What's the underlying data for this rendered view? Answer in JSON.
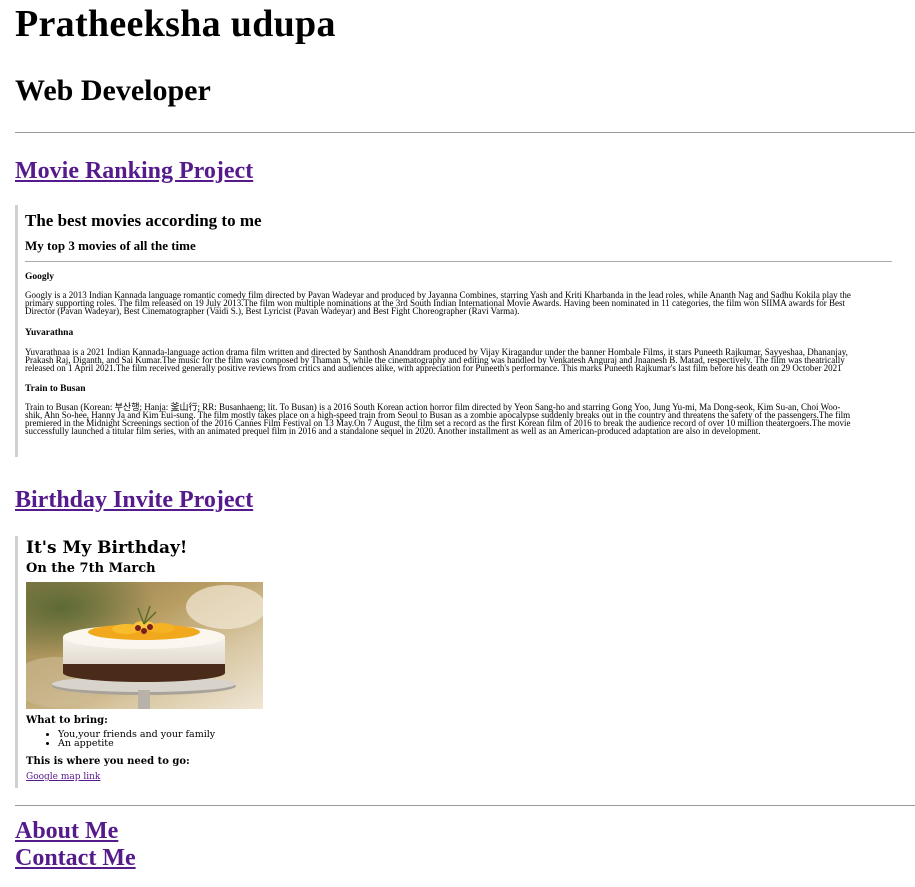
{
  "header": {
    "name": "Pratheeksha udupa",
    "role": "Web Developer"
  },
  "projects": {
    "movie_link": "Movie Ranking Project",
    "birthday_link": "Birthday Invite Project"
  },
  "movie_page": {
    "title": "The best movies according to me",
    "subtitle": "My top 3 movies of all the time",
    "movies": [
      {
        "name": "Googly",
        "line1": "Googly is a 2013 Indian Kannada language romantic comedy film directed by Pavan Wadeyar and produced by Jayanna Combines, starring Yash and Kriti Kharbanda in the lead roles, while Ananth Nag and Sadhu Kokila play the",
        "line2": "primary supporting roles. The film released on 19 July 2013.The film won multiple nominations at the 3rd South Indian International Movie Awards. Having been nominated in 11 categories, the film won SIIMA awards for Best",
        "line3": "Director (Pavan Wadeyar), Best Cinematographer (Vaidi S.), Best Lyricist (Pavan Wadeyar) and Best Fight Choreographer (Ravi Varma)."
      },
      {
        "name": "Yuvarathna",
        "line1": "Yuvarathnaa is a 2021 Indian Kannada-language action drama film written and directed by Santhosh Ananddram produced by Vijay Kiragandur under the banner Hombale Films, it stars Puneeth Rajkumar, Sayyeshaa, Dhananjay,",
        "line2": "Prakash Raj, Diganth, and Sai Kumar.The music for the film was composed by Thaman S, while the cinematography and editing was handled by Venkatesh Anguraj and Jnaanesh B. Matad, respectively. The film was theatrically",
        "line3": "released on 1 April 2021.The film received generally positive reviews from critics and audiences alike, with appreciation for Puneeth's performance. This marks Puneeth Rajkumar's last film before his death on 29 October 2021"
      },
      {
        "name": "Train to Busan",
        "line1": "Train to Busan (Korean: 부산행; Hanja: 釜山行; RR: Busanhaeng; lit. To Busan) is a 2016 South Korean action horror film directed by Yeon Sang-ho and starring Gong Yoo, Jung Yu-mi, Ma Dong-seok, Kim Su-an, Choi Woo-",
        "line2": "shik, Ahn So-hee, Hanny Ja and Kim Eui-sung. The film mostly takes place on a high-speed train from Seoul to Busan as a zombie apocalypse suddenly breaks out in the country and threatens the safety of the passengers.The film",
        "line3": "premiered in the Midnight Screenings section of the 2016 Cannes Film Festival on 13 May.On 7 August, the film set a record as the first Korean film of 2016 to break the audience record of over 10 million theatergoers.The movie",
        "line4": "successfully launched a titular film series, with an animated prequel film in 2016 and a standalone sequel in 2020. Another installment as well as an American-produced adaptation are also in development."
      }
    ]
  },
  "birthday_page": {
    "title": "It's My Birthday!",
    "date": "On the 7th March",
    "bring_heading": "What to bring:",
    "bring_items": [
      "You,your friends and your family",
      "An appetite"
    ],
    "where_heading": "This is where you need to go:",
    "map_link": "Google map link"
  },
  "footer": {
    "about": "About Me",
    "contact": "Contact Me"
  },
  "colors": {
    "link": "#551a8b",
    "rule": "#9a9a9a"
  }
}
